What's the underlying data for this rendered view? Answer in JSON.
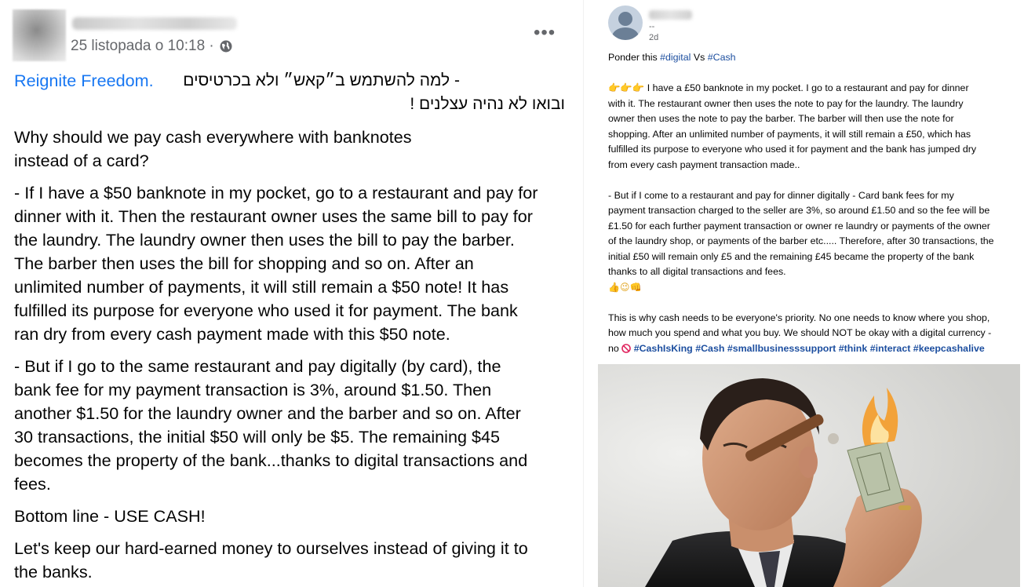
{
  "left_post": {
    "date": "25 listopada o 10:18 ·",
    "page_link": "Reignite Freedom.",
    "hebrew_line_1": "- למה להשתמש ב״קאש״ ולא בכרטיסים",
    "hebrew_line_2": "ובואו לא נהיה עצלנים !",
    "paragraphs": [
      [
        "Why should we pay cash everywhere with banknotes",
        "instead of a card?"
      ],
      [
        "- If I have a $50 banknote in my pocket, go to a restaurant and pay for",
        "dinner with it. Then the restaurant owner uses the same bill to pay for",
        "the laundry. The laundry owner then uses the bill to pay the barber.",
        "The barber then uses the bill for shopping and so on. After an",
        "unlimited number of payments, it will still remain a $50 note! It has",
        "fulfilled its purpose for everyone who used it for payment. The bank",
        "ran dry from every cash payment made with this $50 note."
      ],
      [
        "- But if I go to the same restaurant and pay digitally (by card), the",
        "bank fee for my payment transaction is 3%, around $1.50. Then",
        "another $1.50 for the laundry owner and the barber and so on. After",
        "30 transactions, the initial $50 will only be $5. The remaining $45",
        "becomes the property of the bank...thanks to digital transactions and",
        "fees."
      ],
      [
        "Bottom line - USE CASH!"
      ],
      [
        "Let's keep our hard-earned money to ourselves instead of giving it to",
        "the banks."
      ]
    ],
    "icons": {
      "globe": "globe-icon",
      "more": "more-options-icon"
    }
  },
  "right_post": {
    "dashes": "--",
    "time": "2d",
    "intro_prefix": "Ponder this ",
    "intro_tag1": "#digital",
    "intro_mid": " Vs ",
    "intro_tag2": "#Cash",
    "para1": [
      "👉👉👉 I have a £50 banknote in my pocket. I go to a restaurant and pay for dinner",
      "with it. The restaurant owner then uses the note to pay for the laundry. The laundry",
      "owner then uses the note to pay the barber. The barber will then use the note for",
      "shopping. After an unlimited number of payments, it will still remain a £50, which has",
      "fulfilled its purpose to everyone who used it for payment and the bank has jumped dry",
      "from every cash payment transaction made.."
    ],
    "para2": [
      "- But if I come to a restaurant and pay for dinner digitally - Card bank fees for my",
      "payment transaction charged to the seller are 3%, so around £1.50 and so the fee will be",
      "£1.50 for each further payment transaction or owner re laundry or payments of the owner",
      "of the laundry shop, or payments of the barber etc..... Therefore, after 30 transactions, the",
      "initial £50 will remain only £5 and the remaining £45 became the property of the bank",
      "thanks to all digital transactions and fees."
    ],
    "emoji_row": "👍😉👊",
    "para3": [
      "This is why cash needs to be everyone's priority. No one needs to know where you shop,",
      "how much you spend and what you buy. We should NOT be okay with a digital currency -"
    ],
    "last_prefix": "no",
    "hashtags": [
      "#CashIsKing",
      "#Cash",
      "#smallbusinesssupport",
      "#think",
      "#interact",
      "#keepcashalive"
    ],
    "colors": {
      "link": "#1877f2",
      "hashtag": "#1c4e9f",
      "meta": "#65676b"
    }
  }
}
